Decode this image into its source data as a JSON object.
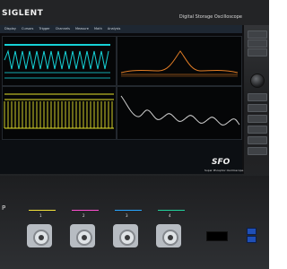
{
  "brand": "SIGLENT",
  "model_text": "Digital Storage Oscilloscope",
  "logo_text": "SFO",
  "logo_subtitle": "Super Phosphor Oscilloscope",
  "menu": [
    "Display",
    "Cursors",
    "Trigger",
    "Channels",
    "Measure",
    "Math",
    "Analysis"
  ],
  "left_partial_label": "P",
  "channels": [
    {
      "number": "1",
      "color": "#f2e33a"
    },
    {
      "number": "2",
      "color": "#ff4fd0"
    },
    {
      "number": "3",
      "color": "#27a6ff"
    },
    {
      "number": "4",
      "color": "#21d29c"
    }
  ],
  "colors": {
    "panel_title": "#c8cdd2",
    "trace_cyan": "#16d1d6",
    "trace_yellow": "#e5e22b",
    "trace_orange": "#e17d26",
    "trace_spectrum": "#cfcfcf"
  }
}
